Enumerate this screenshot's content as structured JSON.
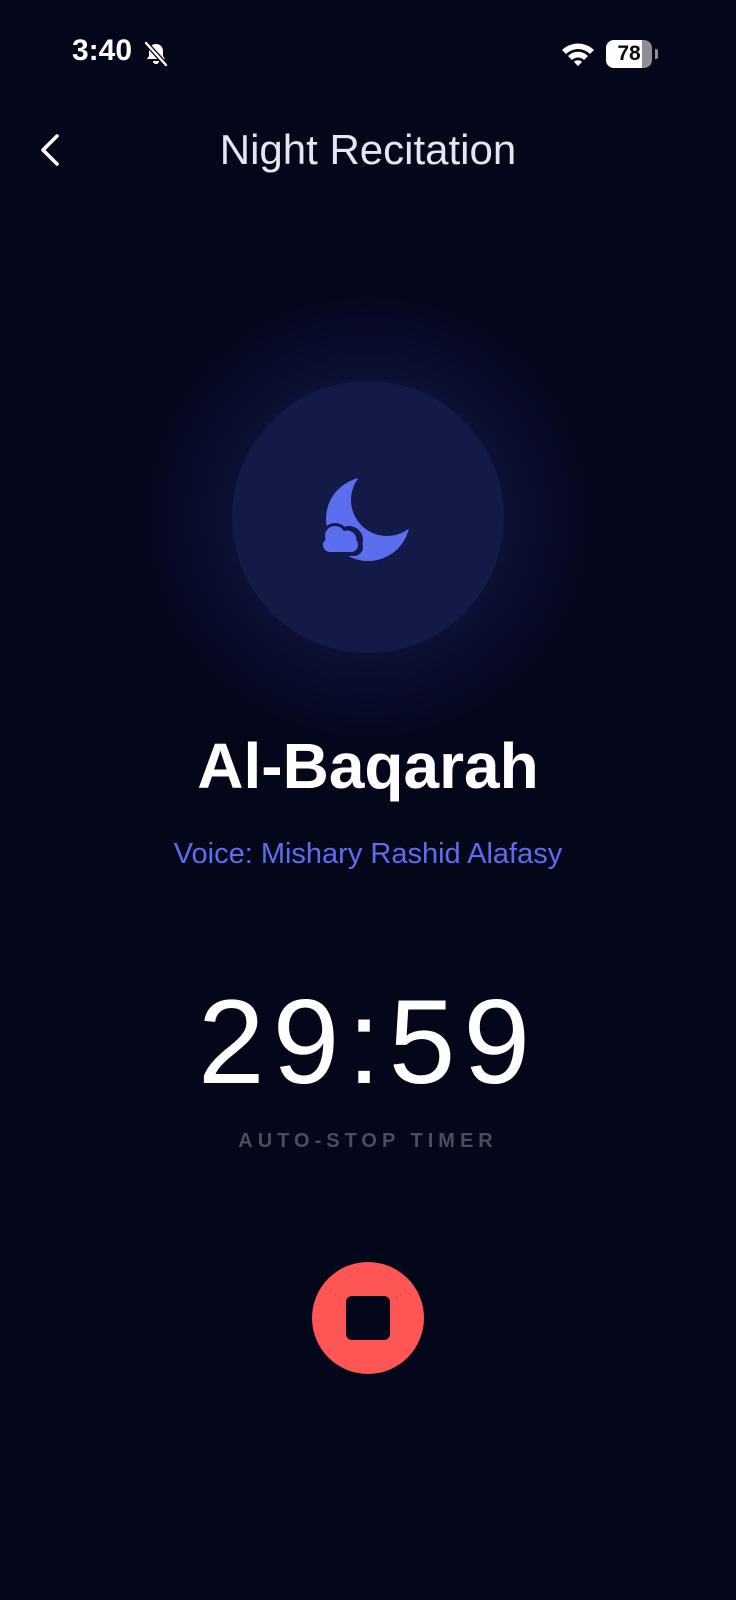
{
  "status_bar": {
    "time": "3:40",
    "battery_level": "78",
    "battery_fraction": 0.78
  },
  "header": {
    "title": "Night Recitation"
  },
  "player": {
    "icon": "moon-cloud-icon",
    "surah": "Al-Baqarah",
    "reciter": "Voice: Mishary Rashid Alafasy",
    "timer": "29:59",
    "timer_label": "AUTO-STOP TIMER"
  },
  "colors": {
    "background": "#04061a",
    "accent": "#5b6ef0",
    "stop": "#fe5655",
    "muted_label": "#4a4d5c"
  }
}
